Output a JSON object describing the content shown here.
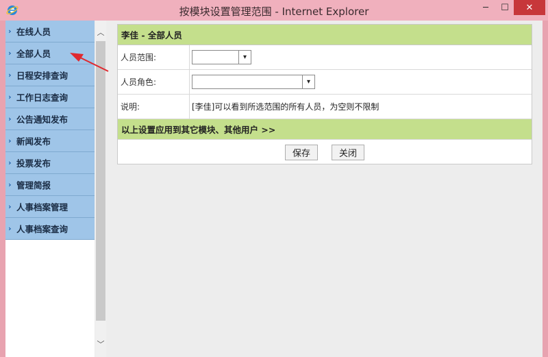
{
  "window": {
    "title": "按模块设置管理范围 - Internet Explorer",
    "minimize_glyph": "─",
    "maximize_glyph": "☐",
    "close_glyph": "✕",
    "icon": "ie-icon"
  },
  "sidebar": {
    "items": [
      {
        "label": "在线人员"
      },
      {
        "label": "全部人员"
      },
      {
        "label": "日程安排查询"
      },
      {
        "label": "工作日志查询"
      },
      {
        "label": "公告通知发布"
      },
      {
        "label": "新闻发布"
      },
      {
        "label": "投票发布"
      },
      {
        "label": "管理简报"
      },
      {
        "label": "人事档案管理"
      },
      {
        "label": "人事档案查询"
      }
    ],
    "chevron_glyph": "›",
    "scroll_up_glyph": "︿",
    "scroll_down_glyph": "﹀"
  },
  "panel": {
    "header": "李佳 - 全部人员",
    "range_label": "人员范围:",
    "range_value": "",
    "role_label": "人员角色:",
    "role_value": "",
    "note_label": "说明:",
    "note_text": "[李佳]可以看到所选范围的所有人员，为空则不限制",
    "apply_text": "以上设置应用到其它模块、其他用户 >>",
    "save_label": "保存",
    "close_label": "关闭",
    "dropdown_glyph": "▾"
  },
  "colors": {
    "nav_bg": "#9fc5e8",
    "header_green": "#c4df8c",
    "titlebar": "#f0b0bd",
    "close_red": "#c7373a",
    "annotation_arrow": "#e0292f"
  }
}
